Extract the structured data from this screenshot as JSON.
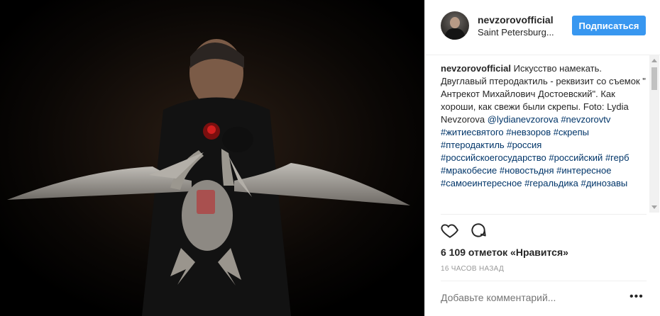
{
  "post": {
    "username": "nevzorovofficial",
    "location": "Saint Petersburg...",
    "follow_label": "Подписаться",
    "caption": {
      "owner": "nevzorovofficial",
      "text": "Искусство намекать. Двуглавый птеродактиль - реквизит со съемок \" Антрекот Михайлович Достоевский\". Как хороши, как свежи были скрепы. Foto: Lydia Nevzorova",
      "tags": [
        "@lydianevzorova",
        "#nevzorovtv",
        "#житиесвятого",
        "#невзоров",
        "#скрепы",
        "#птеродактиль",
        "#россия",
        "#российскоегосударство",
        "#российский",
        "#герб",
        "#мракобесие",
        "#новостьдня",
        "#интересное",
        "#самоеинтересное",
        "#геральдика",
        "#динозавы"
      ]
    },
    "icons": {
      "like": "heart-icon",
      "comment": "comment-icon",
      "more": "more-options-icon"
    },
    "likes": "6 109 отметок «Нравится»",
    "time": "16 часов назад",
    "comment_placeholder": "Добавьте комментарий...",
    "more_label": "•••",
    "colors": {
      "follow_bg": "#3897f0",
      "hashtag": "#003569",
      "muted": "#999999"
    }
  }
}
